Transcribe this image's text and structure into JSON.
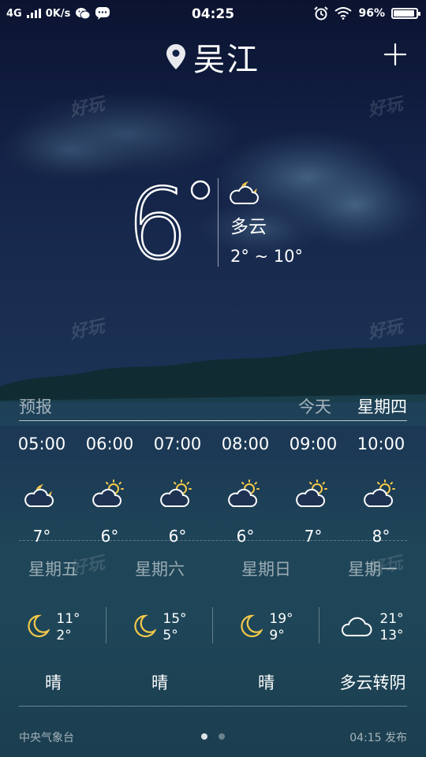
{
  "status_bar": {
    "network": "4G",
    "speed": "0K/s",
    "time": "04:25",
    "battery": "96%",
    "battery_level": 0.96
  },
  "header": {
    "city": "吴江"
  },
  "current": {
    "temperature": "6°",
    "temp_digit": "6",
    "condition": "多云",
    "range": "2° ~ 10°"
  },
  "watermark": "好玩",
  "forecast": {
    "title": "预报",
    "today_label": "今天",
    "weekday_label": "星期四",
    "hours": [
      {
        "time": "05:00",
        "icon": "partly-cloudy-night-icon",
        "temp": "7°"
      },
      {
        "time": "06:00",
        "icon": "partly-cloudy-day-icon",
        "temp": "6°"
      },
      {
        "time": "07:00",
        "icon": "partly-cloudy-day-icon",
        "temp": "6°"
      },
      {
        "time": "08:00",
        "icon": "partly-cloudy-day-icon",
        "temp": "6°"
      },
      {
        "time": "09:00",
        "icon": "partly-cloudy-day-icon",
        "temp": "7°"
      },
      {
        "time": "10:00",
        "icon": "partly-cloudy-day-icon",
        "temp": "8°"
      }
    ]
  },
  "days": [
    {
      "name": "星期五",
      "high": "11°",
      "low": "2°",
      "icon": "moon-icon",
      "desc": "晴"
    },
    {
      "name": "星期六",
      "high": "15°",
      "low": "5°",
      "icon": "moon-icon",
      "desc": "晴"
    },
    {
      "name": "星期日",
      "high": "19°",
      "low": "9°",
      "icon": "moon-icon",
      "desc": "晴"
    },
    {
      "name": "星期一",
      "high": "21°",
      "low": "13°",
      "icon": "cloud-icon",
      "desc": "多云转阴"
    }
  ],
  "footer": {
    "source": "中央气象台",
    "published": "04:15 发布",
    "page_count": 2,
    "active_page": 0
  },
  "colors": {
    "icon_yellow": "#f5c94a",
    "icon_white": "#ffffff"
  }
}
